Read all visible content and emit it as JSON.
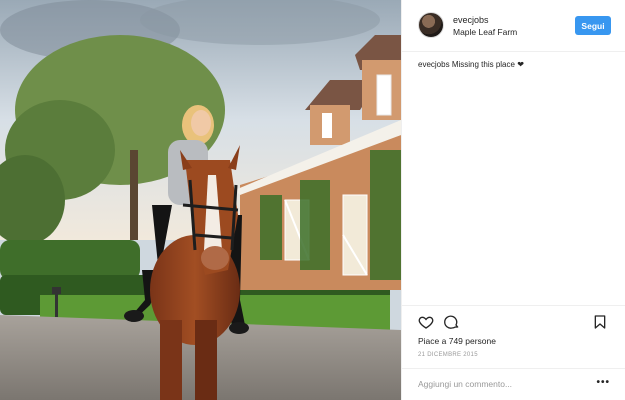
{
  "photo": {
    "description_icon": "photo-image"
  },
  "header": {
    "username": "evecjobs",
    "location": "Maple Leaf Farm",
    "follow_label": "Segui",
    "avatar_icon": "avatar-icon"
  },
  "caption": {
    "username": "evecjobs",
    "text": "Missing this place",
    "emoji": "❤"
  },
  "actions": {
    "like_icon": "heart-icon",
    "comment_icon": "comment-icon",
    "save_icon": "bookmark-icon"
  },
  "likes": "Piace a 749 persone",
  "date": "21 DICEMBRE 2015",
  "comment": {
    "placeholder": "Aggiungi un commento...",
    "more": "•••"
  },
  "colors": {
    "accent": "#3897f0",
    "text": "#262626",
    "muted": "#999999",
    "divider": "#efefef"
  }
}
